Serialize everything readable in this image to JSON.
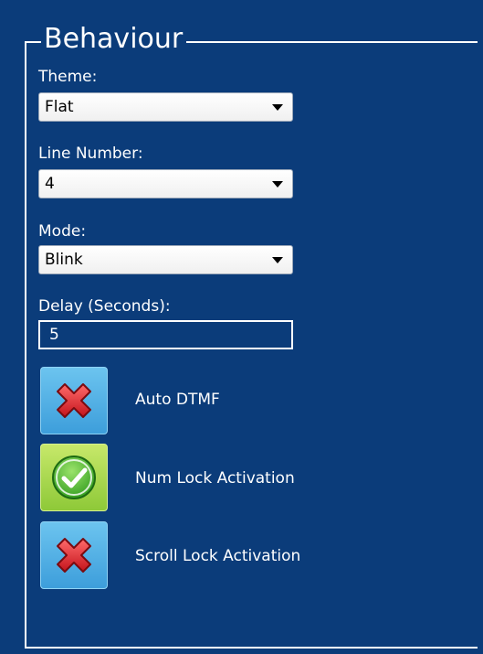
{
  "group": {
    "title": "Behaviour"
  },
  "theme": {
    "label": "Theme:",
    "value": "Flat"
  },
  "line_number": {
    "label": "Line Number:",
    "value": "4"
  },
  "mode": {
    "label": "Mode:",
    "value": "Blink"
  },
  "delay": {
    "label": "Delay (Seconds):",
    "value": "5"
  },
  "toggles": [
    {
      "label": "Auto DTMF",
      "state": "off",
      "icon": "red-x-icon"
    },
    {
      "label": "Num Lock Activation",
      "state": "on",
      "icon": "green-check-icon"
    },
    {
      "label": "Scroll Lock Activation",
      "state": "off",
      "icon": "red-x-icon"
    }
  ],
  "colors": {
    "panel_background": "#0b3c7a",
    "text": "#ffffff",
    "toggle_off_background": "#4aa9e2",
    "toggle_on_background": "#a6d84c"
  }
}
